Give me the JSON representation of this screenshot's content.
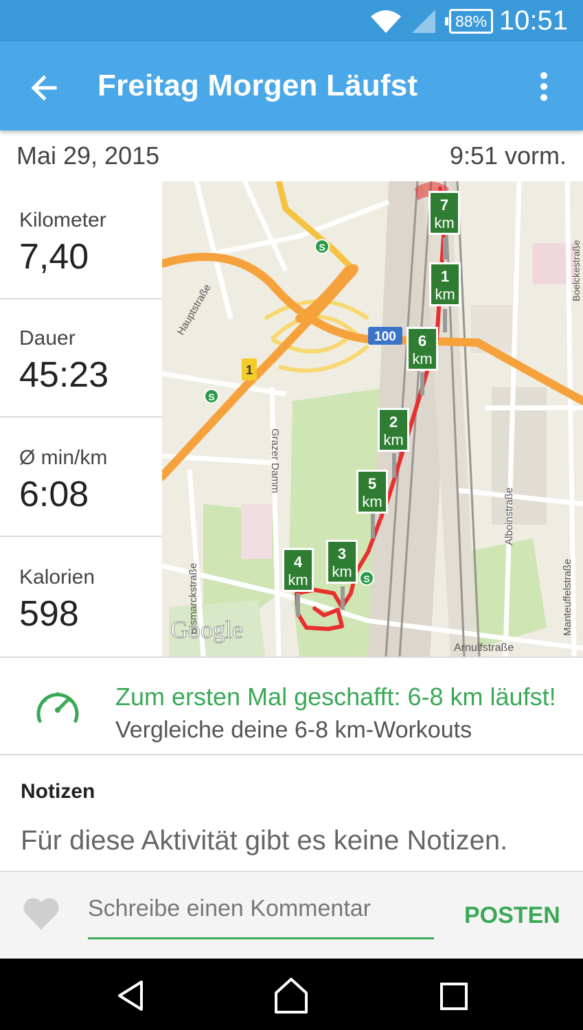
{
  "status_bar": {
    "time": "10:51",
    "battery": "88%",
    "icons": [
      "wifi-icon",
      "cell-signal-icon",
      "battery-icon"
    ]
  },
  "app_bar": {
    "title": "Freitag Morgen Läufst",
    "back_icon": "arrow-left-icon",
    "menu_icon": "more-vert-icon"
  },
  "activity": {
    "date": "Mai 29, 2015",
    "time": "9:51 vorm."
  },
  "stats": [
    {
      "label": "Kilometer",
      "value": "7,40"
    },
    {
      "label": "Dauer",
      "value": "45:23"
    },
    {
      "label": "Ø min/km",
      "value": "6:08"
    },
    {
      "label": "Kalorien",
      "value": "598"
    }
  ],
  "map": {
    "streets": {
      "hauptstrasse": "Hauptstraße",
      "grazer_damm": "Grazer Damm",
      "bismarckstrasse": "Bismarckstraße",
      "alboinstrasse": "Alboinstraße",
      "manteuffelstrasse": "Manteuffelstraße",
      "arnulfstrasse": "Arnulfstraße",
      "boelckestrasse": "Boelckestraße"
    },
    "highway_shields": {
      "a100": "100",
      "b1": "1"
    },
    "station_symbol": "S",
    "watermark": "Google",
    "km_unit": "km",
    "km_markers": [
      "1",
      "2",
      "3",
      "4",
      "5",
      "6",
      "7"
    ],
    "route_color": "#e8312f",
    "marker_color": "#2e7d32"
  },
  "achievement": {
    "icon": "speedometer-icon",
    "title": "Zum ersten Mal geschafft: 6-8 km läufst!",
    "subtitle": "Vergleiche deine 6-8 km-Workouts"
  },
  "notes": {
    "heading": "Notizen",
    "empty_text": "Für diese Aktivität gibt es keine Notizen."
  },
  "comment": {
    "placeholder": "Schreibe einen Kommentar",
    "post_label": "POSTEN",
    "like_icon": "heart-icon"
  },
  "colors": {
    "app_bar": "#4aa8e8",
    "status_bar": "#3a9ad9",
    "accent_green": "#3aa957"
  },
  "nav_bar": {
    "icons": [
      "back-triangle-icon",
      "home-icon",
      "recents-icon"
    ]
  }
}
